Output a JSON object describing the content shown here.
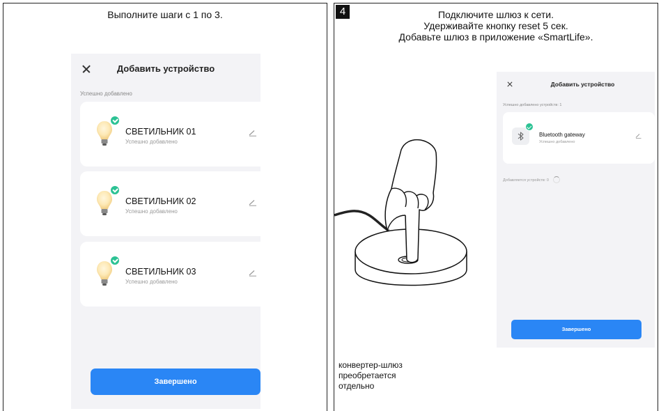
{
  "left_panel": {
    "caption": "Выполните шаги с 1 по 3.",
    "app": {
      "title": "Добавить устройство",
      "section_label": "Успешно добавлено",
      "devices": [
        {
          "name": "СВЕТИЛЬНИК 01",
          "status": "Успешно добавлено",
          "icon": "light-bulb-icon"
        },
        {
          "name": "СВЕТИЛЬНИК 02",
          "status": "Успешно добавлено",
          "icon": "light-bulb-icon"
        },
        {
          "name": "СВЕТИЛЬНИК 03",
          "status": "Успешно добавлено",
          "icon": "light-bulb-icon"
        }
      ],
      "done_label": "Завершено"
    }
  },
  "right_panel": {
    "step_number": "4",
    "caption_lines": [
      "Подключите шлюз к сети.",
      "Удерживайте кнопку reset 5 сек.",
      "Добавьте шлюз в приложение «SmartLife»."
    ],
    "app": {
      "title": "Добавить устройство",
      "section_label": "Успешно добавлено устройств: 1",
      "device": {
        "name": "Bluetooth gateway",
        "status": "Успешно добавлено",
        "icon": "bluetooth-icon"
      },
      "adding_label": "Добавляется устройств: 0",
      "done_label": "Завершено"
    },
    "note_lines": [
      "конвертер-шлюз",
      "преобретается",
      "отдельно"
    ]
  },
  "colors": {
    "accent": "#2a86f5",
    "success": "#2cc294",
    "screen_bg": "#f3f3f6",
    "card_bg": "#ffffff"
  }
}
